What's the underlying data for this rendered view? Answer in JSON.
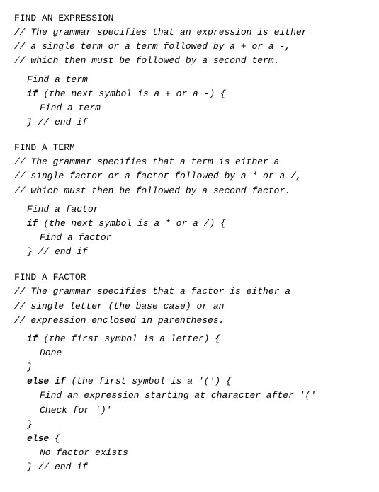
{
  "sections": [
    {
      "id": "find-expression",
      "header": "FIND AN EXPRESSION",
      "comments": [
        "// The grammar specifies that an expression is either",
        "// a single term or a term followed by a + or a -,",
        "// which then must be followed by a second term."
      ],
      "body": [
        {
          "type": "blank"
        },
        {
          "type": "indent1",
          "text": "Find a term"
        },
        {
          "type": "indent1-keyword",
          "keyword": "if",
          "rest": " (the next symbol is a + or a -) {"
        },
        {
          "type": "indent2",
          "text": "Find a term"
        },
        {
          "type": "indent1",
          "text": "}  // end if"
        }
      ]
    },
    {
      "id": "find-term",
      "header": "FIND A TERM",
      "comments": [
        "// The grammar specifies that a term is either a",
        "// single factor or a factor followed by a * or a /,",
        "// which must then be followed by a second factor."
      ],
      "body": [
        {
          "type": "blank"
        },
        {
          "type": "indent1",
          "text": "Find a factor"
        },
        {
          "type": "indent1-keyword",
          "keyword": "if",
          "rest": " (the next symbol is a * or a /) {"
        },
        {
          "type": "indent2",
          "text": "Find a factor"
        },
        {
          "type": "indent1",
          "text": "}  // end if"
        }
      ]
    },
    {
      "id": "find-factor",
      "header": "FIND A FACTOR",
      "comments": [
        "// The grammar specifies that a factor is either a",
        "// single letter (the base case) or an",
        "// expression enclosed in parentheses."
      ],
      "body": [
        {
          "type": "blank"
        },
        {
          "type": "indent1-keyword",
          "keyword": "if",
          "rest": " (the first symbol is a letter) {"
        },
        {
          "type": "indent2",
          "text": "Done"
        },
        {
          "type": "indent1",
          "text": "}"
        },
        {
          "type": "indent1-keyword-else-if",
          "keyword1": "else",
          "keyword2": "if",
          "rest": " (the first symbol is a '(') {"
        },
        {
          "type": "indent2",
          "text": "Find an expression starting at character after '('"
        },
        {
          "type": "indent2",
          "text": "Check for ')'"
        },
        {
          "type": "indent1",
          "text": "}"
        },
        {
          "type": "indent1-keyword-else",
          "keyword": "else",
          "rest": " {"
        },
        {
          "type": "indent2",
          "text": "No factor exists"
        },
        {
          "type": "indent1",
          "text": "}  // end if"
        }
      ]
    }
  ]
}
